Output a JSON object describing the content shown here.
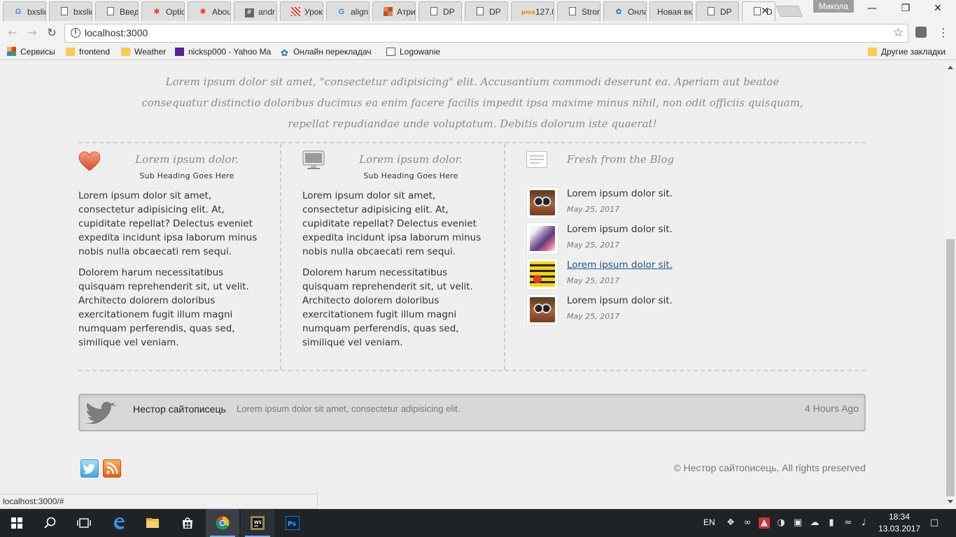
{
  "browser": {
    "tabs": [
      {
        "label": "bxslid",
        "icon": "google-icon"
      },
      {
        "label": "bxslid",
        "icon": "page-icon"
      },
      {
        "label": "Введ",
        "icon": "page-icon"
      },
      {
        "label": "Optic",
        "icon": "star-icon"
      },
      {
        "label": "Abou",
        "icon": "star-icon"
      },
      {
        "label": "andr",
        "icon": "hash-icon"
      },
      {
        "label": "Урок",
        "icon": "stripes-icon"
      },
      {
        "label": "align",
        "icon": "google-icon"
      },
      {
        "label": "Атри",
        "icon": "blocks-icon"
      },
      {
        "label": "DP",
        "icon": "page-icon"
      },
      {
        "label": "DP",
        "icon": "page-icon"
      },
      {
        "label": "127.0",
        "icon": "pma-icon"
      },
      {
        "label": "Stron",
        "icon": "page-icon"
      },
      {
        "label": "Онла",
        "icon": "flower-icon"
      },
      {
        "label": "Новая вк",
        "icon": ""
      },
      {
        "label": "DP",
        "icon": "page-icon"
      },
      {
        "label": "D",
        "icon": "page-icon",
        "active": true
      }
    ],
    "profile_name": "Микола",
    "url": "localhost:3000",
    "bookmarks": [
      {
        "label": "Сервисы",
        "icon": "apps-icon"
      },
      {
        "label": "frontend",
        "icon": "folder-icon"
      },
      {
        "label": "Weather",
        "icon": "folder-icon"
      },
      {
        "label": "nicksp000 - Yahoo Ma",
        "icon": "mail-icon"
      },
      {
        "label": "Онлайн перекладач",
        "icon": "flower-icon"
      },
      {
        "label": "Logowanie",
        "icon": "page-icon"
      }
    ],
    "other_bookmarks": "Другие закладки",
    "status_url": "localhost:3000/#"
  },
  "page": {
    "quote": "Lorem ipsum dolor sit amet, \"consectetur adipisicing\" elit. Accusantium commodi deserunt ea. Aperiam aut beatae consequatur distinctio doloribus ducimus ea enim facere facilis impedit ipsa maxime minus nihil, non odit officiis quisquam, repellat repudiandae unde voluptatum. Debitis dolorum iste quaerat!",
    "columns": [
      {
        "icon": "heart-icon",
        "title": "Lorem ipsum dolor.",
        "subtitle": "Sub Heading Goes Here",
        "p1": "Lorem ipsum dolor sit amet, consectetur adipisicing elit. At, cupiditate repellat? Delectus eveniet expedita incidunt ipsa laborum minus nobis nulla obcaecati rem sequi.",
        "p2": "Dolorem harum necessitatibus quisquam reprehenderit sit, ut velit. Architecto dolorem doloribus exercitationem fugit illum magni numquam perferendis, quas sed, similique vel veniam."
      },
      {
        "icon": "monitor-icon",
        "title": "Lorem ipsum dolor.",
        "subtitle": "Sub Heading Goes Here",
        "p1": "Lorem ipsum dolor sit amet, consectetur adipisicing elit. At, cupiditate repellat? Delectus eveniet expedita incidunt ipsa laborum minus nobis nulla obcaecati rem sequi.",
        "p2": "Dolorem harum necessitatibus quisquam reprehenderit sit, ut velit. Architecto dolorem doloribus exercitationem fugit illum magni numquam perferendis, quas sed, similique vel veniam."
      }
    ],
    "blog": {
      "title": "Fresh from the Blog",
      "icon": "newspaper-icon",
      "posts": [
        {
          "title": "Lorem ipsum dolor sit.",
          "date": "May 25, 2017"
        },
        {
          "title": "Lorem ipsum dolor sit.",
          "date": "May 25, 2017"
        },
        {
          "title": "Lorem ipsum dolor sit.",
          "date": "May 25, 2017"
        },
        {
          "title": "Lorem ipsum dolor sit.",
          "date": "May 25, 2017"
        }
      ]
    },
    "tweet": {
      "author": "Нестор сайтописець",
      "text": "Lorem ipsum dolor sit amet, consectetur adipisicing elit.",
      "time": "4 Hours Ago"
    },
    "footer": {
      "copyright": "© Нестор сайтописець, All rights preserved"
    }
  },
  "taskbar": {
    "language": "EN",
    "time": "18:34",
    "date": "13.03.2017"
  }
}
